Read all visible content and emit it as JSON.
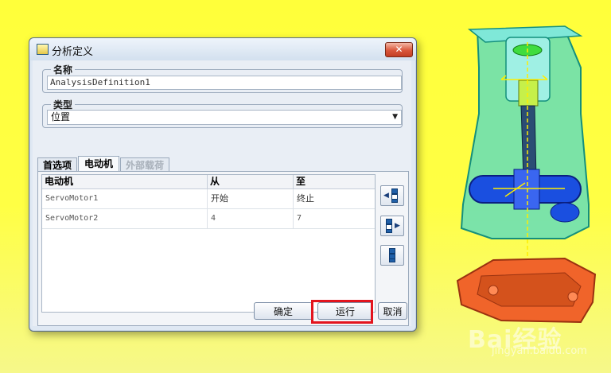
{
  "window": {
    "title": "分析定义",
    "close_label": "✕"
  },
  "name_group": {
    "legend": "名称",
    "value": "AnalysisDefinition1"
  },
  "type_group": {
    "legend": "类型",
    "selected": "位置"
  },
  "tabs": [
    {
      "label": "首选项",
      "state": "normal"
    },
    {
      "label": "电动机",
      "state": "active"
    },
    {
      "label": "外部载荷",
      "state": "disabled"
    }
  ],
  "motor_table": {
    "headers": [
      "电动机",
      "从",
      "至"
    ],
    "rows": [
      [
        "ServoMotor1",
        "开始",
        "终止"
      ],
      [
        "ServoMotor2",
        "4",
        "7"
      ]
    ]
  },
  "side_buttons": [
    "add-motor-icon",
    "edit-motor-icon",
    "table-icon"
  ],
  "buttons": {
    "ok": "确定",
    "run": "运行",
    "cancel": "取消"
  },
  "colors": {
    "highlight": "#e3141d",
    "background": "#ffff3a",
    "model_teal": "#4fd9c8",
    "model_orange": "#f0642a",
    "model_blue": "#1a4fe0"
  },
  "watermark": {
    "brand": "Bai经验",
    "url": "jingyan.baidu.com"
  }
}
